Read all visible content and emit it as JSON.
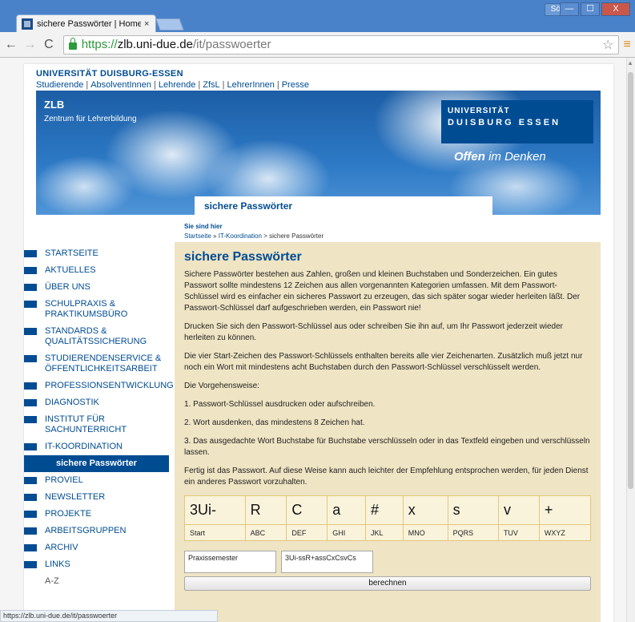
{
  "browser": {
    "tab_title": "sichere Passwörter | Home",
    "tab_close": "×",
    "profile": "Sören",
    "win_min": "—",
    "win_max": "☐",
    "win_close": "X",
    "back": "←",
    "forward": "→",
    "reload": "C",
    "url_scheme": "https://",
    "url_host": "zlb.uni-due.de",
    "url_path": "/it/passwoerter",
    "star": "☆",
    "menu": "≡",
    "status_url": "https://zlb.uni-due.de/it/passwoerter"
  },
  "site": {
    "university": "UNIVERSITÄT DUISBURG-ESSEN",
    "topnav": [
      "Studierende",
      "AbsolventInnen",
      "Lehrende",
      "ZfsL",
      "LehrerInnen",
      "Presse"
    ],
    "topnav_sep": "|",
    "zlb_title": "ZLB",
    "zlb_subtitle": "Zentrum für Lehrerbildung",
    "logo_line1": "UNIVERSITÄT",
    "logo_line2": "DUISBURG ESSEN",
    "slogan_bold": "Offen",
    "slogan_rest": " im Denken",
    "banner_label": "sichere Passwörter",
    "breadcrumb_head": "Sie sind hier",
    "breadcrumb": {
      "home": "Startseite",
      "sep1": " » ",
      "section": "IT-Koordination",
      "sep2": " > ",
      "current": "sichere Passwörter"
    }
  },
  "sidebar": {
    "items": [
      {
        "label": "STARTSEITE"
      },
      {
        "label": "AKTUELLES"
      },
      {
        "label": "ÜBER UNS"
      },
      {
        "label": "SCHULPRAXIS & PRAKTIKUMSBÜRO"
      },
      {
        "label": "STANDARDS & QUALITÄTSSICHERUNG"
      },
      {
        "label": "STUDIERENDENSERVICE & ÖFFENTLICHKEITSARBEIT"
      },
      {
        "label": "PROFESSIONSENTWICKLUNG"
      },
      {
        "label": "DIAGNOSTIK"
      },
      {
        "label": "INSTITUT FÜR SACHUNTERRICHT"
      },
      {
        "label": "IT-KOORDINATION"
      },
      {
        "label": "sichere Passwörter"
      },
      {
        "label": "PROVIEL"
      },
      {
        "label": "NEWSLETTER"
      },
      {
        "label": "PROJEKTE"
      },
      {
        "label": "ARBEITSGRUPPEN"
      },
      {
        "label": "ARCHIV"
      },
      {
        "label": "LINKS"
      },
      {
        "label": "A-Z"
      }
    ]
  },
  "content": {
    "heading": "sichere Passwörter",
    "paragraphs": [
      "Sichere Passwörter bestehen aus Zahlen, großen und kleinen Buchstaben und Sonderzeichen. Ein gutes Passwort sollte mindestens 12 Zeichen aus allen vorgenannten Kategorien umfassen. Mit dem Passwort-Schlüssel wird es einfacher ein sicheres Passwort zu erzeugen, das sich später sogar wieder herleiten läßt. Der Passwort-Schlüssel darf aufgeschrieben werden, ein Passwort nie!",
      "Drucken Sie sich den Passwort-Schlüssel aus oder schreiben Sie ihn auf, um Ihr Passwort jederzeit wieder herleiten zu können.",
      "Die vier Start-Zeichen des Passwort-Schlüssels enthalten bereits alle vier Zeichenarten. Zusätzlich muß jetzt nur noch ein Wort mit mindestens acht Buchstaben durch den Passwort-Schlüssel verschlüsselt werden.",
      "Die Vorgehensweise:",
      "1. Passwort-Schlüssel ausdrucken oder aufschreiben.",
      "2. Wort ausdenken, das mindestens 8 Zeichen hat.",
      "3. Das ausgedachte Wort Buchstabe für Buchstabe verschlüsseln oder in das Textfeld eingeben und verschlüsseln lassen.",
      "Fertig ist das Passwort. Auf diese Weise kann auch leichter der Empfehlung entsprochen werden, für jeden Dienst ein anderes Passwort vorzuhalten."
    ],
    "key_table": {
      "symbols": [
        "3Ui-",
        "R",
        "C",
        "a",
        "#",
        "x",
        "s",
        "v",
        "+"
      ],
      "labels": [
        "Start",
        "ABC",
        "DEF",
        "GHI",
        "JKL",
        "MNO",
        "PQRS",
        "TUV",
        "WXYZ"
      ]
    },
    "input_word": "Praxissemester",
    "output_password": "3Ui-ssR+assCxCsvCs",
    "button_label": "berechnen"
  }
}
